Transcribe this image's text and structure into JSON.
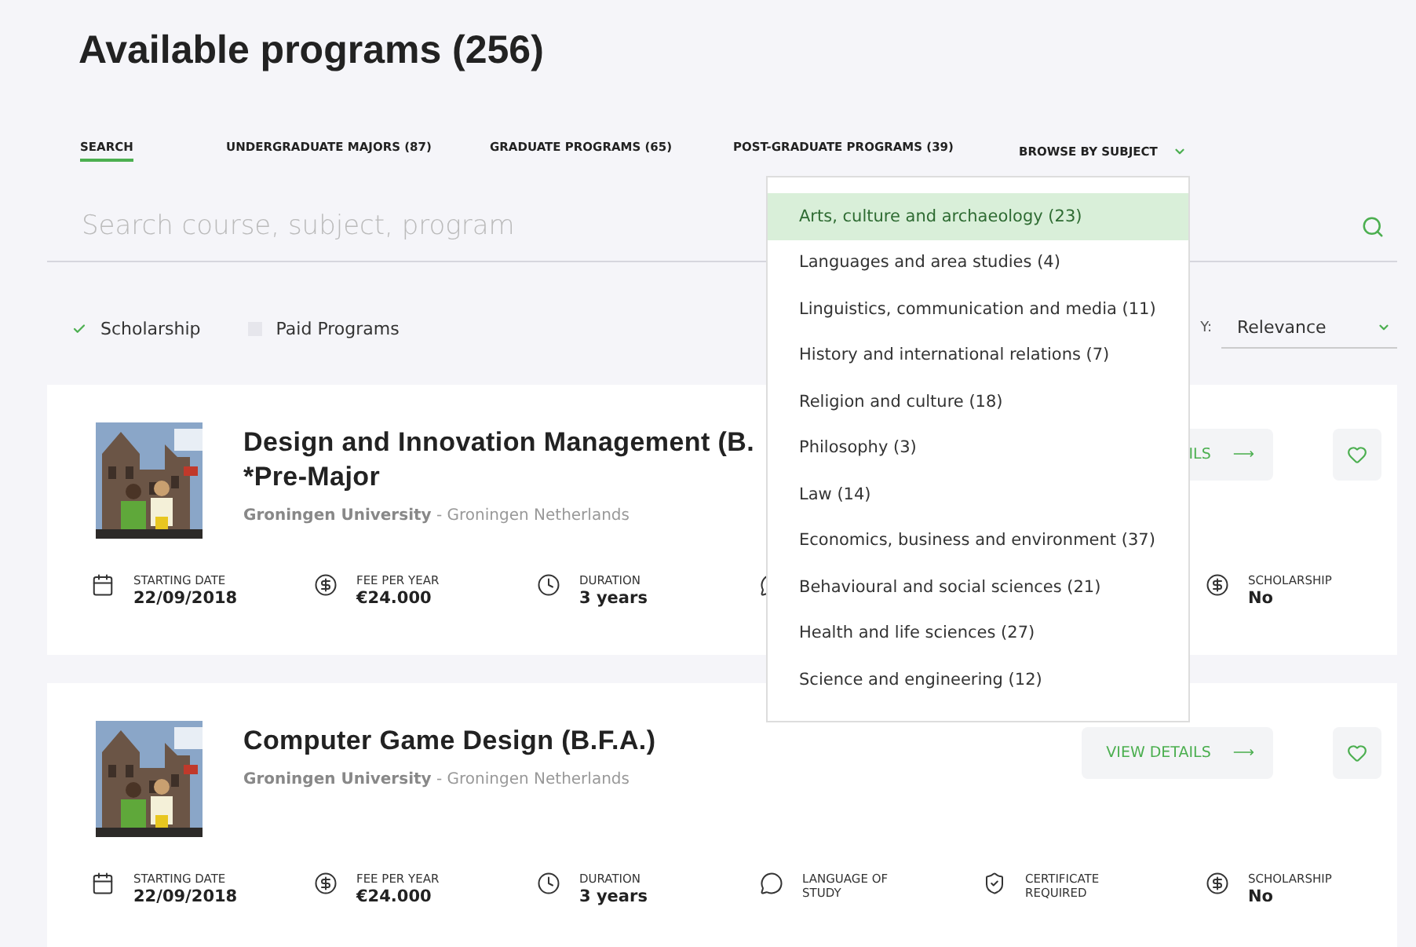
{
  "heading": "Available programs (256)",
  "tabs": [
    {
      "label": "SEARCH",
      "selected": true
    },
    {
      "label": "UNDERGRADUATE MAJORS (87)",
      "selected": false
    },
    {
      "label": "GRADUATE PROGRAMS (65)",
      "selected": false
    },
    {
      "label": "POST-GRADUATE PROGRAMS (39)",
      "selected": false
    },
    {
      "label": "BROWSE BY SUBJECT",
      "selected": false,
      "kind": "dropdown"
    }
  ],
  "search": {
    "placeholder": "Search course, subject, program"
  },
  "filters": [
    {
      "label": "Scholarship",
      "checked": true
    },
    {
      "label": "Paid Programs",
      "checked": false
    }
  ],
  "sort": {
    "label": "Y:",
    "value": "Relevance"
  },
  "subject_menu": [
    {
      "label": "Arts, culture and archaeology (23)",
      "selected": true
    },
    {
      "label": "Languages and area studies (4)",
      "selected": false
    },
    {
      "label": "Linguistics, communication and media (11)",
      "selected": false
    },
    {
      "label": "History and international relations (7)",
      "selected": false
    },
    {
      "label": "Religion and culture (18)",
      "selected": false
    },
    {
      "label": "Philosophy (3)",
      "selected": false
    },
    {
      "label": "Law (14)",
      "selected": false
    },
    {
      "label": "Economics, business and environment (37)",
      "selected": false
    },
    {
      "label": "Behavioural and social sciences (21)",
      "selected": false
    },
    {
      "label": "Health and life sciences (27)",
      "selected": false
    },
    {
      "label": "Science and engineering (12)",
      "selected": false
    }
  ],
  "programs": [
    {
      "title": "Design and Innovation Management (B.",
      "title_line_2": "*Pre-Major",
      "university": "Groningen University",
      "separator": "-",
      "location": "Groningen Netherlands",
      "button": "ILS",
      "arrow": "⟶",
      "details": [
        {
          "kind": "date",
          "label": "STARTING DATE",
          "value": "22/09/2018"
        },
        {
          "kind": "fee",
          "label": "FEE PER YEAR",
          "value": "€24.000"
        },
        {
          "kind": "duration",
          "label": "DURATION",
          "value": "3 years"
        },
        {
          "kind": "language"
        },
        {
          "kind": "scholarship",
          "label": "SCHOLARSHIP",
          "value": "No"
        }
      ]
    },
    {
      "title": "Computer Game Design (B.F.A.)",
      "university": "Groningen University",
      "separator": "-",
      "location": "Groningen Netherlands",
      "button": "VIEW DETAILS",
      "arrow": "⟶",
      "details": [
        {
          "kind": "date",
          "label": "STARTING DATE",
          "value": "22/09/2018"
        },
        {
          "kind": "fee",
          "label": "FEE PER YEAR",
          "value": "€24.000"
        },
        {
          "kind": "duration",
          "label": "DURATION",
          "value": "3 years"
        },
        {
          "kind": "language",
          "label": "LANGUAGE OF STUDY"
        },
        {
          "kind": "certificate",
          "label": "CERTIFICATE REQUIRED"
        },
        {
          "kind": "scholarship",
          "label": "SCHOLARSHIP",
          "value": "No"
        }
      ]
    }
  ]
}
